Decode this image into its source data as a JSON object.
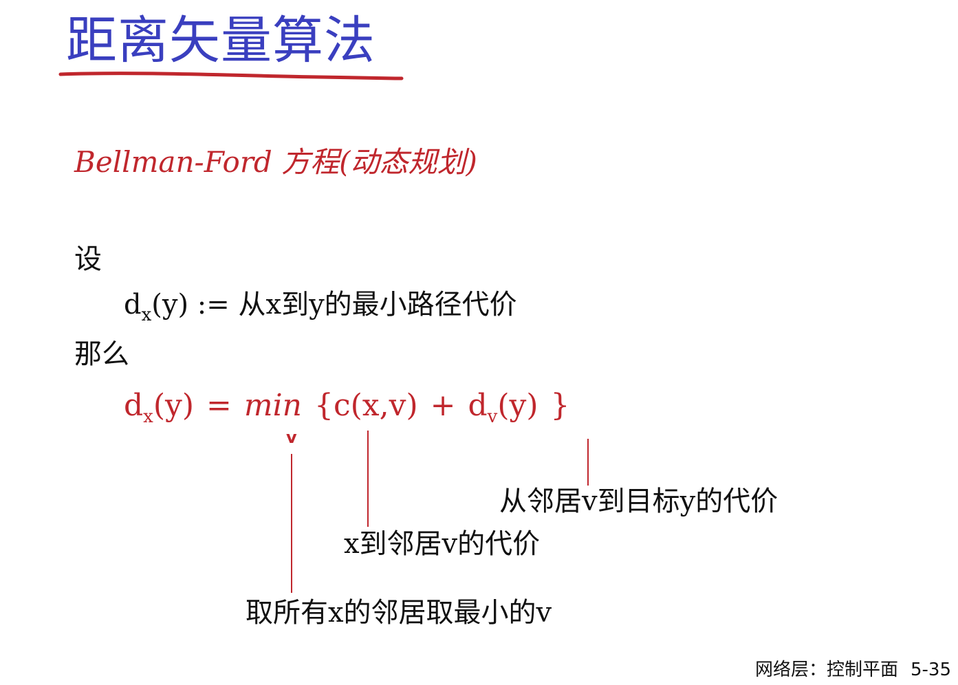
{
  "slide": {
    "title": "距离矢量算法",
    "subtitle": "Bellman-Ford 方程(动态规划)",
    "let_label": "设",
    "definition": {
      "d": "d",
      "sub": "x",
      "rest": "(y) := 从x到y的最小路径代价"
    },
    "then_label": "那么",
    "equation": {
      "d": "d",
      "sub_x": "x",
      "part1": "(y) = ",
      "min": "min",
      "part2": " {c(x,v) + d",
      "sub_v": "v",
      "part3": "(y) }",
      "caret": "v"
    },
    "annotations": {
      "neighbor_to_dest": "从邻居v到目标y的代价",
      "x_to_neighbor": "x到邻居v的代价",
      "min_over_neighbors": "取所有x的邻居取最小的v"
    },
    "footer": {
      "section": "网络层：控制平面",
      "page": "5-35"
    }
  },
  "colors": {
    "title": "#3a3fbf",
    "accent_red": "#c0272d",
    "text": "#111111"
  }
}
